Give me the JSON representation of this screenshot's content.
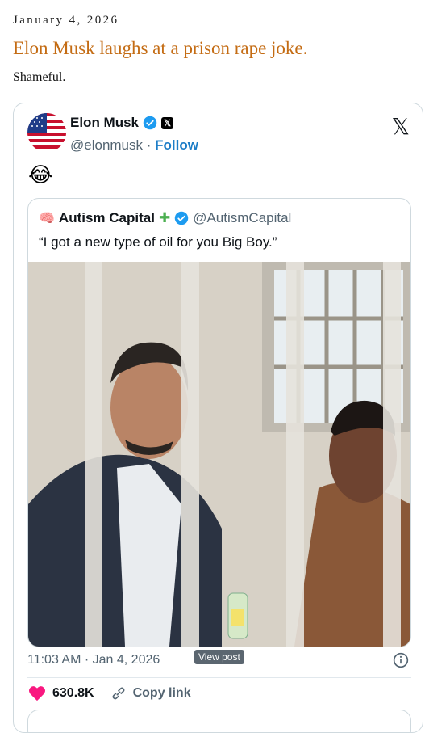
{
  "post": {
    "date": "January 4, 2026",
    "headline": "Elon Musk laughs at a prison rape joke.",
    "subtext": "Shameful."
  },
  "tweet": {
    "author_name": "Elon Musk",
    "author_handle": "@elonmusk",
    "separator": "·",
    "follow_label": "Follow",
    "text": "😂",
    "timestamp": "11:03 AM · Jan 4, 2026",
    "view_post_label": "View post",
    "likes": "630.8K",
    "copy_link_label": "Copy link",
    "icons": [
      "verified-icon",
      "x-badge-icon",
      "x-logo-icon",
      "info-icon",
      "heart-icon",
      "link-icon"
    ],
    "colors": {
      "verified": "#1d9bf0",
      "follow": "#1d7dc7",
      "heart": "#f91880",
      "headline": "#c46c14"
    }
  },
  "quoted": {
    "author_name": "Autism Capital",
    "author_handle": "@AutismCapital",
    "text": "“I got a new type of oil for you Big Boy.”",
    "image_label": "Baby Oil"
  }
}
